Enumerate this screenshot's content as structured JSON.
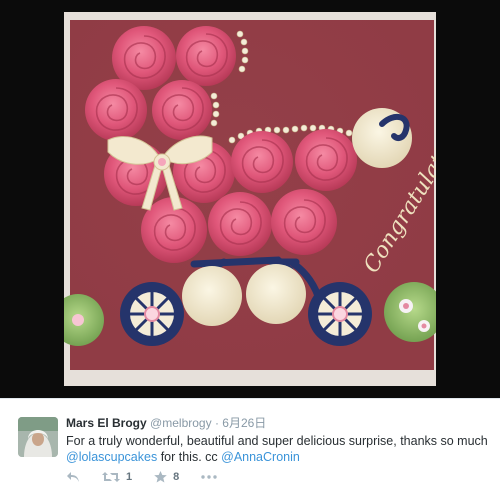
{
  "photo": {
    "cake_text": "Congratulations"
  },
  "tweet": {
    "name": "Mars El Brogy",
    "handle": "@melbrogy",
    "separator": "·",
    "date": "6月26日",
    "text_before": "For a truly wonderful, beautiful and super delicious surprise, thanks so much",
    "mention1": "@lolascupcakes",
    "text_middle": " for this. cc ",
    "mention2": "@AnnaCronin",
    "retweet_count": "1",
    "favorite_count": "8"
  },
  "icons": [
    "reply-icon",
    "retweet-icon",
    "favorite-icon",
    "more-icon"
  ],
  "colors": {
    "frosting": "#e25a78",
    "tray": "#8e3c44",
    "wheel_blue": "#25346b",
    "link": "#3b94d9",
    "muted": "#8899a6"
  }
}
